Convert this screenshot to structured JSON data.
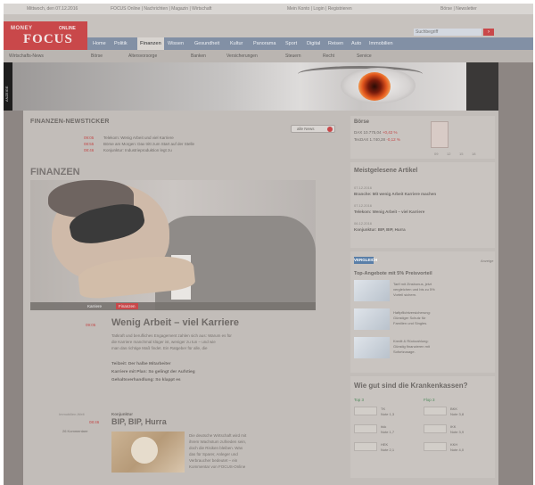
{
  "topbar": {
    "date": "Mittwoch, den 07.12.2016",
    "tagline": "FOCUS Online | Nachrichten | Magazin | Wirtschaft",
    "links": [
      "Mein Konto",
      "Login",
      "Registrieren"
    ],
    "right": "Börse | Newsletter"
  },
  "header": {
    "logo_sub": "MONEY",
    "logo_online": "ONLINE",
    "logo_main": "FOCUS",
    "search_placeholder": "Suchbegriff",
    "search_hint": "erweiterte Suche"
  },
  "nav": {
    "items": [
      "Home",
      "Politik",
      "Finanzen",
      "Wissen",
      "Gesundheit",
      "Kultur",
      "Panorama",
      "Sport",
      "Digital",
      "Reisen",
      "Auto",
      "Immobilien"
    ],
    "active_index": 2
  },
  "subnav": {
    "items": [
      "Wirtschafts-News",
      "Börse",
      "Altersvorsorge",
      "Banken",
      "Versicherungen",
      "Steuern",
      "Recht",
      "Service"
    ]
  },
  "banner": {
    "ad_label": "ANZEIGE"
  },
  "newsticker": {
    "title": "FINANZEN-NEWSTICKER",
    "all_news": "alle News",
    "items": [
      {
        "time": "09:05",
        "text": "Telekom: Wenig Arbeit und viel Karriere"
      },
      {
        "time": "08:55",
        "text": "Börse am Morgen: Dax tritt zum Start auf der Stelle"
      },
      {
        "time": "08:46",
        "text": "Konjunktur: Industrieproduktion legt zu"
      }
    ]
  },
  "section_title": "FINANZEN",
  "hero": {
    "caption_left": "Karriere",
    "caption_tag": "Finanzen"
  },
  "article1": {
    "time": "09:05",
    "title": "Wenig Arbeit – viel Karriere",
    "teaser": [
      "Tatkraft und berufliches Engagement zahlen sich aus: Warum es für",
      "die Karriere manchmal klüger ist, weniger zu tun – und wie",
      "man das richtige Maß findet. Ein Ratgeber für alle, die"
    ],
    "links": [
      "Teilzeit: Der halbe Mitarbeiter",
      "Karriere mit Plan: So gelingt der Aufstieg",
      "Gehaltsverhandlung: So klappt es"
    ]
  },
  "article2": {
    "kicker_meta": "Immobilien-Welt",
    "time": "08:46",
    "comments": "26 Kommentare",
    "kicker": "Konjunktur",
    "title": "BIP, BIP, Hurra",
    "body": [
      "Die deutsche Wirtschaft wird mit",
      "ihrem Wachstum zufrieden sein,",
      "doch die Risiken bleiben. Was",
      "das für Sparer, Anleger und",
      "Verbraucher bedeutet – ein",
      "Kommentar von FOCUS-Online"
    ]
  },
  "stock": {
    "title": "Börse",
    "rows": [
      {
        "name": "DAX",
        "value": "10.775,04",
        "change": "+0,42 %"
      },
      {
        "name": "TecDAX",
        "value": "1.740,28",
        "change": "-0,12 %"
      }
    ],
    "x_labels": [
      "09",
      "12",
      "15",
      "18"
    ]
  },
  "mostread": {
    "title": "Meistgelesene Artikel",
    "items": [
      {
        "date": "07.12.2016",
        "title": "Branche: Mit wenig Arbeit Karriere machen"
      },
      {
        "date": "07.12.2016",
        "title": "Telekom: Wenig Arbeit – viel Karriere"
      },
      {
        "date": "06.12.2016",
        "title": "Konjunktur: BIP, BIP, Hurra"
      }
    ]
  },
  "promo": {
    "badge": "VERGLEICH",
    "anzeige": "Anzeige",
    "title": "Top-Angebote mit 5% Preisvorteil",
    "items": [
      [
        "Tarif mit Zinsbonus, jetzt",
        "vergleichen und bis zu 5%",
        "Vorteil sichern."
      ],
      [
        "Haftpflichtversicherung:",
        "Günstiger Schutz für",
        "Familien und Singles."
      ],
      [
        "Kredit & Rückzahlung:",
        "Günstig finanzieren mit",
        "Sofortzusage."
      ]
    ]
  },
  "kk": {
    "title": "Wie gut sind die Krankenkassen?",
    "col1": "Top 3",
    "col2": "Flop 3",
    "left": [
      [
        "Note 1,3",
        "TK"
      ],
      [
        "Note 1,7",
        "hkk"
      ],
      [
        "Note 2,1",
        "HEK"
      ]
    ],
    "right": [
      [
        "Note 3,8",
        "BKK"
      ],
      [
        "Note 3,9",
        "IKK"
      ],
      [
        "Note 4,0",
        "KKH"
      ]
    ]
  },
  "colors": {
    "brand_red": "#c9484a",
    "nav_blue": "#8290a5",
    "page_bg": "#8d8683",
    "content_bg": "#c2bdb9"
  }
}
